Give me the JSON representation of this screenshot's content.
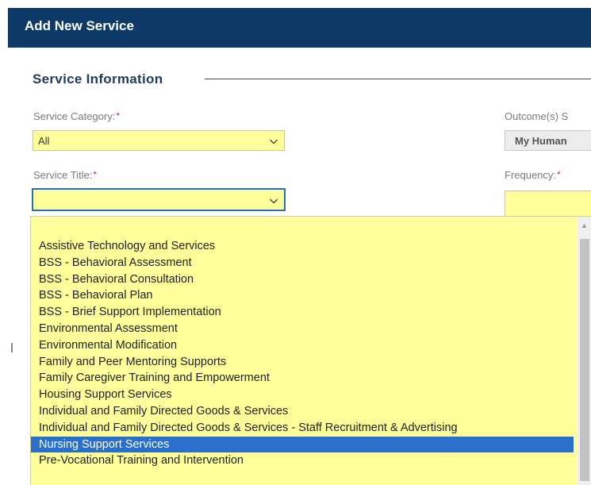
{
  "header": {
    "title": "Add New Service"
  },
  "section": {
    "title": "Service Information"
  },
  "fields": {
    "service_category": {
      "label": "Service Category:",
      "required": "*",
      "value": "All"
    },
    "service_title": {
      "label": "Service Title:",
      "required": "*",
      "value": ""
    },
    "outcomes": {
      "label": "Outcome(s) S",
      "value": "My Human"
    },
    "frequency": {
      "label": "Frequency:",
      "required": "*",
      "value": ""
    }
  },
  "dropdown": {
    "options": [
      "Assistive Technology and Services",
      "BSS - Behavioral Assessment",
      "BSS - Behavioral Consultation",
      "BSS - Behavioral Plan",
      "BSS - Brief Support Implementation",
      "Environmental Assessment",
      "Environmental Modification",
      "Family and Peer Mentoring Supports",
      "Family Caregiver Training and Empowerment",
      "Housing Support Services",
      "Individual and Family Directed Goods & Services",
      "Individual and Family Directed Goods & Services - Staff Recruitment & Advertising",
      "Nursing Support Services",
      "Pre-Vocational Training and Intervention"
    ],
    "selected_index": 12
  },
  "colors": {
    "header_bg": "#0d3a66",
    "field_bg": "#fefe9a",
    "selected_bg": "#2a6fcb"
  }
}
